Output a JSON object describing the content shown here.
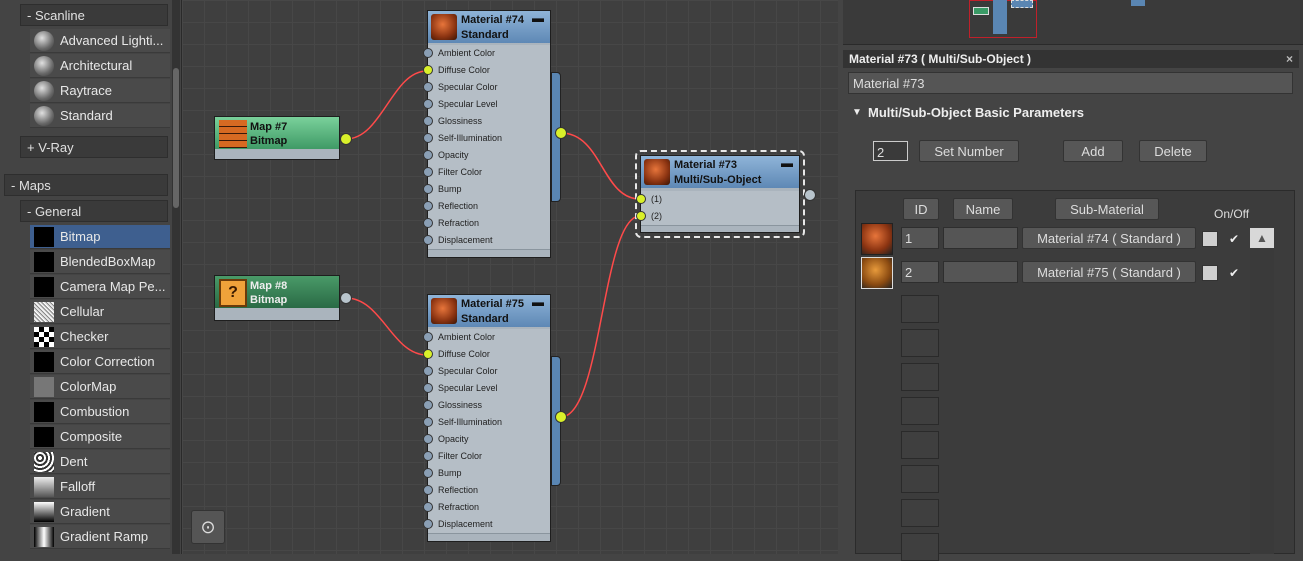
{
  "left_panel": {
    "scanline_header": "- Scanline",
    "scanline_items": [
      {
        "label": "Advanced Lighti...",
        "swatch": "sphere"
      },
      {
        "label": "Architectural",
        "swatch": "sphere"
      },
      {
        "label": "Raytrace",
        "swatch": "sphere"
      },
      {
        "label": "Standard",
        "swatch": "sphere"
      }
    ],
    "vray_header": "+ V-Ray",
    "maps_header": "- Maps",
    "general_header": "- General",
    "map_items": [
      {
        "label": "Bitmap",
        "swatch": "black"
      },
      {
        "label": "BlendedBoxMap",
        "swatch": "black"
      },
      {
        "label": "Camera Map Pe...",
        "swatch": "black"
      },
      {
        "label": "Cellular",
        "swatch": "noise"
      },
      {
        "label": "Checker",
        "swatch": "checker"
      },
      {
        "label": "Color Correction",
        "swatch": "black"
      },
      {
        "label": "ColorMap",
        "swatch": "gray"
      },
      {
        "label": "Combustion",
        "swatch": "black"
      },
      {
        "label": "Composite",
        "swatch": "black"
      },
      {
        "label": "Dent",
        "swatch": "dent"
      },
      {
        "label": "Falloff",
        "swatch": "falloff"
      },
      {
        "label": "Gradient",
        "swatch": "gradient"
      },
      {
        "label": "Gradient Ramp",
        "swatch": "ramp"
      }
    ],
    "selected_item": "Bitmap"
  },
  "canvas": {
    "slot_labels": [
      "Ambient Color",
      "Diffuse Color",
      "Specular Color",
      "Specular Level",
      "Glossiness",
      "Self-Illumination",
      "Opacity",
      "Filter Color",
      "Bump",
      "Reflection",
      "Refraction",
      "Displacement"
    ],
    "material_74": {
      "title": "Material #74",
      "type": "Standard",
      "minimize": "▬"
    },
    "material_75": {
      "title": "Material #75",
      "type": "Standard",
      "minimize": "▬"
    },
    "multi": {
      "title": "Material #73",
      "type": "Multi/Sub-Object",
      "minimize": "▬",
      "slots": [
        "(1)",
        "(2)"
      ]
    },
    "map_7": {
      "title": "Map #7",
      "type": "Bitmap"
    },
    "map_8": {
      "title": "Map #8",
      "type": "Bitmap",
      "icon_glyph": "?"
    },
    "accent_wire": "#ff4a4a"
  },
  "right_panel": {
    "panel_title": "Material #73  ( Multi/Sub-Object )",
    "close_glyph": "×",
    "name_value": "Material #73",
    "rollout_title": "Multi/Sub-Object Basic Parameters",
    "count_value": "2",
    "set_number_label": "Set Number",
    "add_label": "Add",
    "delete_label": "Delete",
    "col_id": "ID",
    "col_name": "Name",
    "col_submaterial": "Sub-Material",
    "col_onoff": "On/Off",
    "rows": [
      {
        "id": "1",
        "name": "",
        "submaterial": "Material #74  ( Standard )",
        "on": "✔"
      },
      {
        "id": "2",
        "name": "",
        "submaterial": "Material #75  ( Standard )",
        "on": "✔"
      }
    ],
    "scroll_up_glyph": "▲"
  }
}
